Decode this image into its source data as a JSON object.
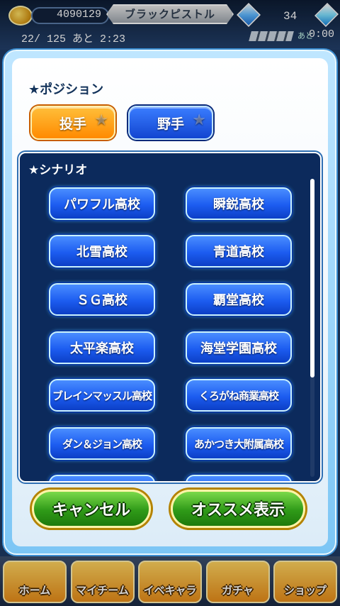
{
  "status_bar": {
    "coins": "4090129",
    "title": "ブラックピストル",
    "gems": "34",
    "stamina": "22/ 125",
    "stamina_suffix": "あと 2:23",
    "timer_label": "あと",
    "timer_value": "0:00"
  },
  "modal": {
    "position_section": {
      "title": "★ポジション",
      "options": [
        {
          "label": "投手",
          "selected": true
        },
        {
          "label": "野手",
          "selected": false
        }
      ]
    },
    "scenario_section": {
      "title": "★シナリオ",
      "schools": [
        "パワフル高校",
        "瞬鋭高校",
        "北雪高校",
        "青道高校",
        "ＳＧ高校",
        "覇堂高校",
        "太平楽高校",
        "海堂学園高校",
        "ブレインマッスル高校",
        "くろがね商業高校",
        "ダン＆ジョン高校",
        "あかつき大附属高校"
      ]
    },
    "buttons": {
      "cancel": "キャンセル",
      "recommend": "オススメ表示"
    }
  },
  "bottom_nav": {
    "items": [
      "ホーム",
      "マイチーム",
      "イベキャラ",
      "ガチャ",
      "ショップ"
    ]
  }
}
